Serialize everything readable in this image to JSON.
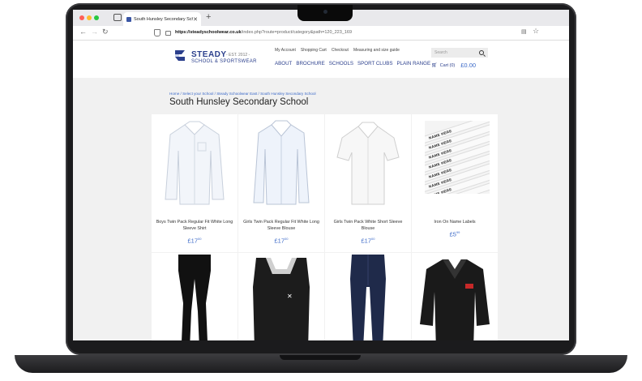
{
  "browser": {
    "tab_title": "South Hunsley Secondary Scho",
    "url_domain": "https://steadyschoolwear.co.uk",
    "url_path": "/index.php?route=product/category&path=120_223_169"
  },
  "header": {
    "logo": {
      "brand": "STEADY",
      "est": "- EST. 2012 -",
      "subtitle": "SCHOOL & SPORTSWEAR"
    },
    "toplinks": [
      "My Account",
      "Shopping Cart",
      "Checkout",
      "Measuring and size guide"
    ],
    "mainnav": [
      "ABOUT",
      "BROCHURE",
      "SCHOOLS",
      "SPORT CLUBS",
      "PLAIN RANGE"
    ],
    "search_placeholder": "Search",
    "cart_label": "Cart (0)",
    "cart_total": "£0.00"
  },
  "breadcrumb": "Home / Select your School / Steady Schoolwear East / South Hunsley Secondary School",
  "page_title": "South Hunsley Secondary School",
  "products": [
    {
      "name": "Boys Twin Pack Regular Fit White Long Sleeve Shirt",
      "price": "£17",
      "price_pence": "00"
    },
    {
      "name": "Girls Twin Pack Regular Fit White Long Sleeve Blouse",
      "price": "£17",
      "price_pence": "00"
    },
    {
      "name": "Girls Twin Pack White Short Sleeve Blouse",
      "price": "£17",
      "price_pence": "00"
    },
    {
      "name": "Iron On Name Labels",
      "price": "£5",
      "price_pence": "99"
    }
  ],
  "label_text": "NAME HERE",
  "colors": {
    "brand_blue": "#2b3f8c",
    "link_blue": "#3b69c8"
  }
}
